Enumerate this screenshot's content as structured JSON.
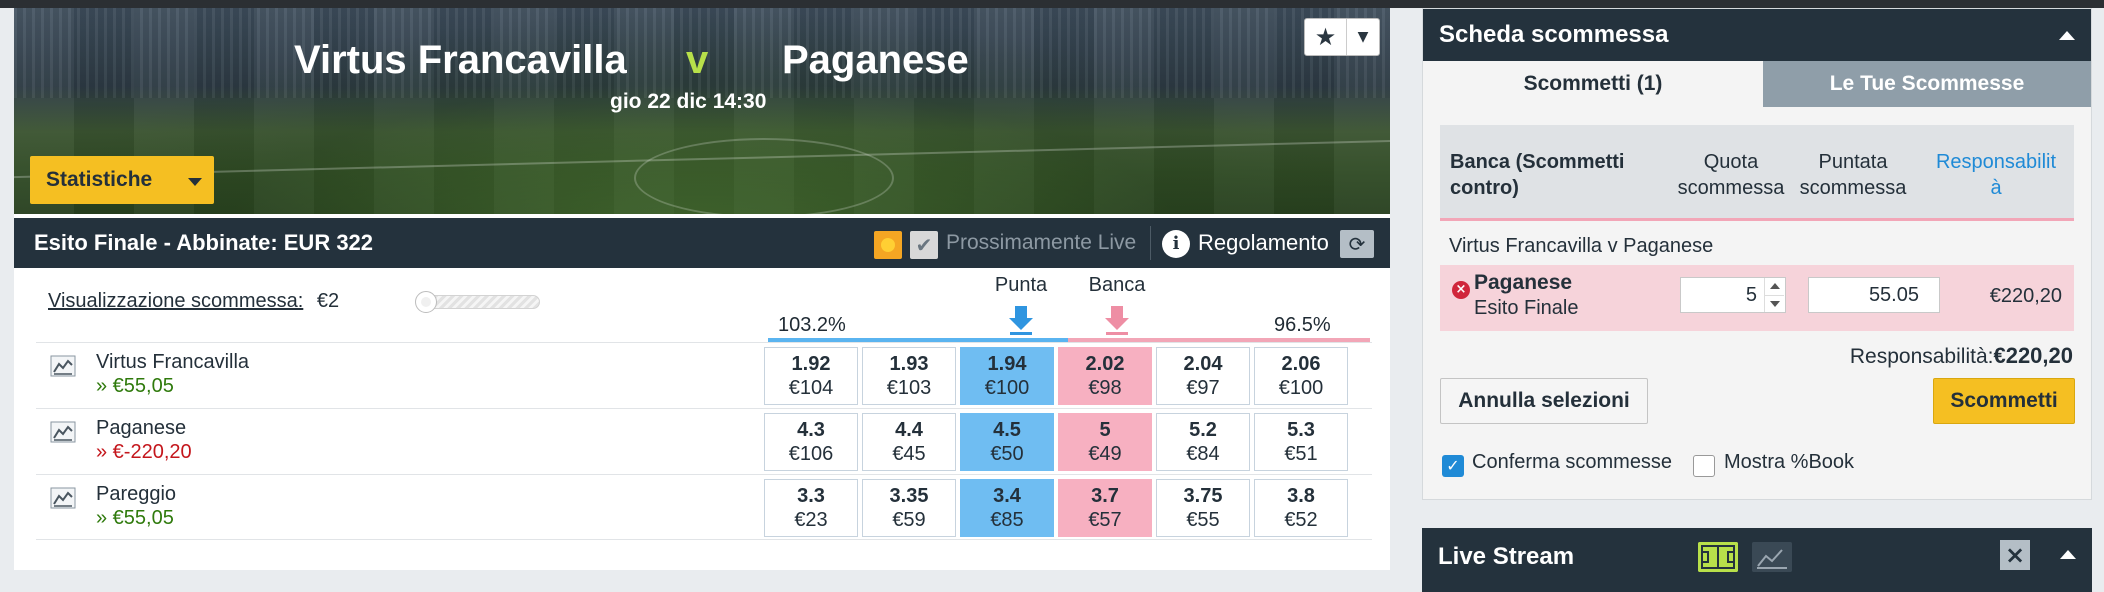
{
  "match": {
    "home": "Virtus Francavilla",
    "vs": "v",
    "away": "Paganese",
    "date": "gio 22 dic 14:30",
    "stats_label": "Statistiche"
  },
  "market": {
    "title": "Esito Finale - Abbinate: EUR 322",
    "live_label": "Prossimamente Live",
    "rules_label": "Regolamento",
    "view_label": "Visualizzazione scommessa:",
    "view_amount": "€2",
    "back_header": "Punta",
    "lay_header": "Banca",
    "back_pct": "103.2%",
    "lay_pct": "96.5%",
    "runners": [
      {
        "name": "Virtus Francavilla",
        "pl": "» €55,05",
        "pl_sign": "pos",
        "prices": [
          {
            "odds": "1.92",
            "size": "€104"
          },
          {
            "odds": "1.93",
            "size": "€103"
          },
          {
            "odds": "1.94",
            "size": "€100"
          },
          {
            "odds": "2.02",
            "size": "€98"
          },
          {
            "odds": "2.04",
            "size": "€97"
          },
          {
            "odds": "2.06",
            "size": "€100"
          }
        ]
      },
      {
        "name": "Paganese",
        "pl": "» €-220,20",
        "pl_sign": "neg",
        "prices": [
          {
            "odds": "4.3",
            "size": "€106"
          },
          {
            "odds": "4.4",
            "size": "€45"
          },
          {
            "odds": "4.5",
            "size": "€50"
          },
          {
            "odds": "5",
            "size": "€49"
          },
          {
            "odds": "5.2",
            "size": "€84"
          },
          {
            "odds": "5.3",
            "size": "€51"
          }
        ]
      },
      {
        "name": "Pareggio",
        "pl": "» €55,05",
        "pl_sign": "pos",
        "prices": [
          {
            "odds": "3.3",
            "size": "€23"
          },
          {
            "odds": "3.35",
            "size": "€59"
          },
          {
            "odds": "3.4",
            "size": "€85"
          },
          {
            "odds": "3.7",
            "size": "€57"
          },
          {
            "odds": "3.75",
            "size": "€55"
          },
          {
            "odds": "3.8",
            "size": "€52"
          }
        ]
      }
    ]
  },
  "betslip": {
    "title": "Scheda scommessa",
    "tab_active": "Scommetti (1)",
    "tab_inactive": "Le Tue Scommesse",
    "col_type_1": "Banca (Scommetti",
    "col_type_2": "contro)",
    "col_odds_1": "Quota",
    "col_odds_2": "scommessa",
    "col_stake_1": "Puntata",
    "col_stake_2": "scommessa",
    "col_liab_1": "Responsabilit",
    "col_liab_2": "à",
    "event": "Virtus Francavilla v Paganese",
    "selection": "Paganese",
    "selection_market": "Esito Finale",
    "odds_value": "5",
    "stake_value": "55.05",
    "liability": "€220,20",
    "total_liab_label": "Responsabilità:",
    "total_liab_value": "€220,20",
    "cancel_label": "Annulla selezioni",
    "place_label": "Scommetti",
    "confirm_label": "Conferma scommesse",
    "book_label": "Mostra %Book"
  },
  "livestream": {
    "title": "Live Stream"
  },
  "colors": {
    "back_best": "#6fbdf2",
    "lay_best": "#f7b0c1",
    "accent_yellow": "#f5bf22",
    "header_dark": "#24323d"
  },
  "icons": [
    "star-icon",
    "chevron-down-icon",
    "info-icon",
    "refresh-icon",
    "chart-icon",
    "arrow-down-blue-icon",
    "arrow-down-pink-icon",
    "remove-icon",
    "pitch-icon",
    "close-icon",
    "collapse-icon"
  ]
}
